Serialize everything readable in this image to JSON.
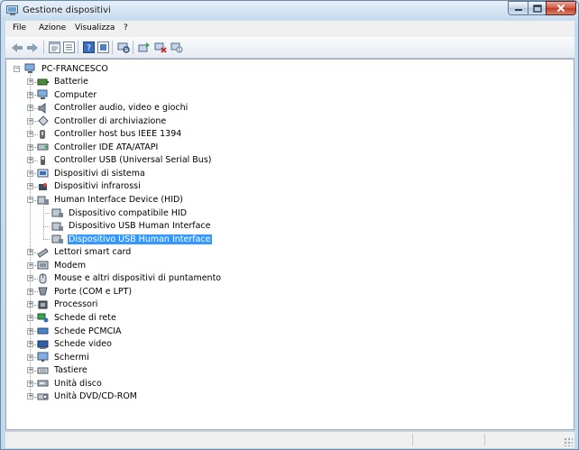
{
  "window": {
    "title": "Gestione dispositivi"
  },
  "menu": [
    "File",
    "Azione",
    "Visualizza",
    "?"
  ],
  "toolbar": {
    "buttons": [
      "back-arrow-icon",
      "forward-arrow-icon",
      "properties-view-icon",
      "list-view-icon",
      "help-icon",
      "properties-icon",
      "scan-hardware-icon",
      "update-driver-icon",
      "disable-device-icon",
      "uninstall-device-icon"
    ]
  },
  "tree": {
    "root": "PC-FRANCESCO",
    "categories": [
      {
        "label": "Batterie",
        "icon": "battery-icon"
      },
      {
        "label": "Computer",
        "icon": "computer-icon"
      },
      {
        "label": "Controller audio, video e giochi",
        "icon": "speaker-icon"
      },
      {
        "label": "Controller di archiviazione",
        "icon": "storage-icon"
      },
      {
        "label": "Controller host bus IEEE 1394",
        "icon": "ieee1394-icon"
      },
      {
        "label": "Controller IDE ATA/ATAPI",
        "icon": "ide-icon"
      },
      {
        "label": "Controller USB (Universal Serial Bus)",
        "icon": "usb-icon"
      },
      {
        "label": "Dispositivi di sistema",
        "icon": "system-devices-icon"
      },
      {
        "label": "Dispositivi infrarossi",
        "icon": "infrared-icon"
      },
      {
        "label": "Human Interface Device (HID)",
        "icon": "hid-icon",
        "expanded": true,
        "children": [
          {
            "label": "Dispositivo compatibile HID"
          },
          {
            "label": "Dispositivo USB Human Interface"
          },
          {
            "label": "Dispositivo USB Human Interface",
            "selected": true
          }
        ]
      },
      {
        "label": "Lettori smart card",
        "icon": "smart-card-icon"
      },
      {
        "label": "Modem",
        "icon": "modem-icon"
      },
      {
        "label": "Mouse e altri dispositivi di puntamento",
        "icon": "mouse-icon"
      },
      {
        "label": "Porte (COM e LPT)",
        "icon": "port-icon"
      },
      {
        "label": "Processori",
        "icon": "processor-icon"
      },
      {
        "label": "Schede di rete",
        "icon": "network-card-icon"
      },
      {
        "label": "Schede PCMCIA",
        "icon": "pcmcia-icon"
      },
      {
        "label": "Schede video",
        "icon": "video-card-icon"
      },
      {
        "label": "Schermi",
        "icon": "monitor-icon"
      },
      {
        "label": "Tastiere",
        "icon": "keyboard-icon"
      },
      {
        "label": "Unità disco",
        "icon": "disk-drive-icon"
      },
      {
        "label": "Unità DVD/CD-ROM",
        "icon": "dvd-drive-icon"
      }
    ]
  },
  "colors": {
    "selection": "#3399ff",
    "title_bar": "#c8dcf0"
  }
}
